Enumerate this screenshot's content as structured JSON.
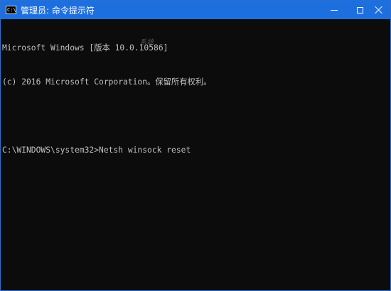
{
  "window": {
    "title": "管理员: 命令提示符",
    "icon": "cmd-icon",
    "icon_label": "C:\\",
    "controls": [
      "minimize-icon",
      "maximize-icon",
      "close-icon"
    ]
  },
  "console": {
    "lines": [
      "Microsoft Windows [版本 10.0.10586]",
      "(c) 2016 Microsoft Corporation。保留所有权利。",
      "",
      "C:\\WINDOWS\\system32>Netsh winsock reset"
    ]
  },
  "watermark": "系统",
  "colors": {
    "titlebar": "#1d6fe0",
    "background": "#0c0c0c",
    "text": "#c0c0c0"
  }
}
